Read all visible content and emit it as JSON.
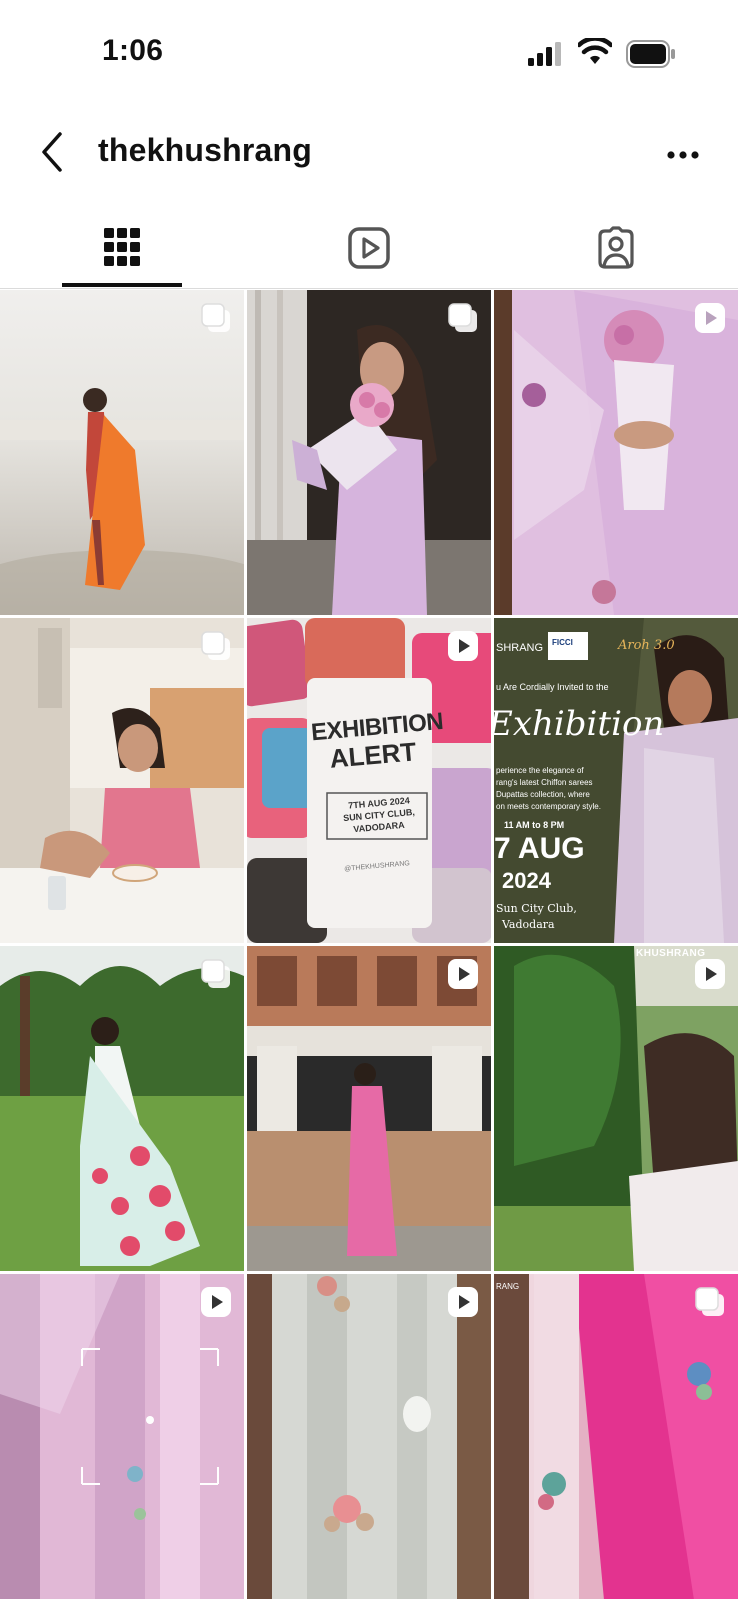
{
  "status_bar": {
    "time": "1:06"
  },
  "header": {
    "username": "thekhushrang"
  },
  "tabs": [
    {
      "name": "grid-tab",
      "icon": "grid-icon",
      "selected": true
    },
    {
      "name": "reels-tab",
      "icon": "reels-icon",
      "selected": false
    },
    {
      "name": "tagged-tab",
      "icon": "tagged-person-icon",
      "selected": false
    }
  ],
  "posts": [
    {
      "type": "carousel",
      "icon": "carousel-icon"
    },
    {
      "type": "carousel",
      "icon": "carousel-icon"
    },
    {
      "type": "reel",
      "icon": "reel-icon"
    },
    {
      "type": "carousel",
      "icon": "carousel-icon"
    },
    {
      "type": "reel",
      "icon": "reel-icon",
      "poster": {
        "line1": "EXHIBITION",
        "line2": "ALERT",
        "date": "7TH AUG 2024",
        "venue1": "SUN CITY CLUB,",
        "venue2": "VADODARA",
        "handle": "@THEKHUSHRANG"
      }
    },
    {
      "type": "post",
      "icon": "none",
      "poster": {
        "brand": "SHRANG",
        "sponsor": "FICCI",
        "event": "Aroh 3.0",
        "invite": "u Are Cordially Invited to the",
        "script": "Exhibition",
        "desc1": "perience the elegance of",
        "desc2": "rang's latest Chiffon sarees",
        "desc3": "Dupattas collection, where",
        "desc4": "on meets contemporary style.",
        "time": "11 AM to 8 PM",
        "date": "7 AUG",
        "year": "2024",
        "venue1": "Sun City Club,",
        "venue2": "Vadodara"
      }
    },
    {
      "type": "carousel",
      "icon": "carousel-icon"
    },
    {
      "type": "reel",
      "icon": "reel-icon"
    },
    {
      "type": "reel",
      "icon": "reel-icon",
      "watermark": "KHUSHRANG"
    },
    {
      "type": "reel",
      "icon": "reel-icon"
    },
    {
      "type": "reel",
      "icon": "reel-icon"
    },
    {
      "type": "carousel",
      "icon": "carousel-icon",
      "watermark": "RANG"
    }
  ],
  "colors": {
    "text": "#111111",
    "border": "#dbdbdb",
    "icon_gray": "#262626"
  }
}
